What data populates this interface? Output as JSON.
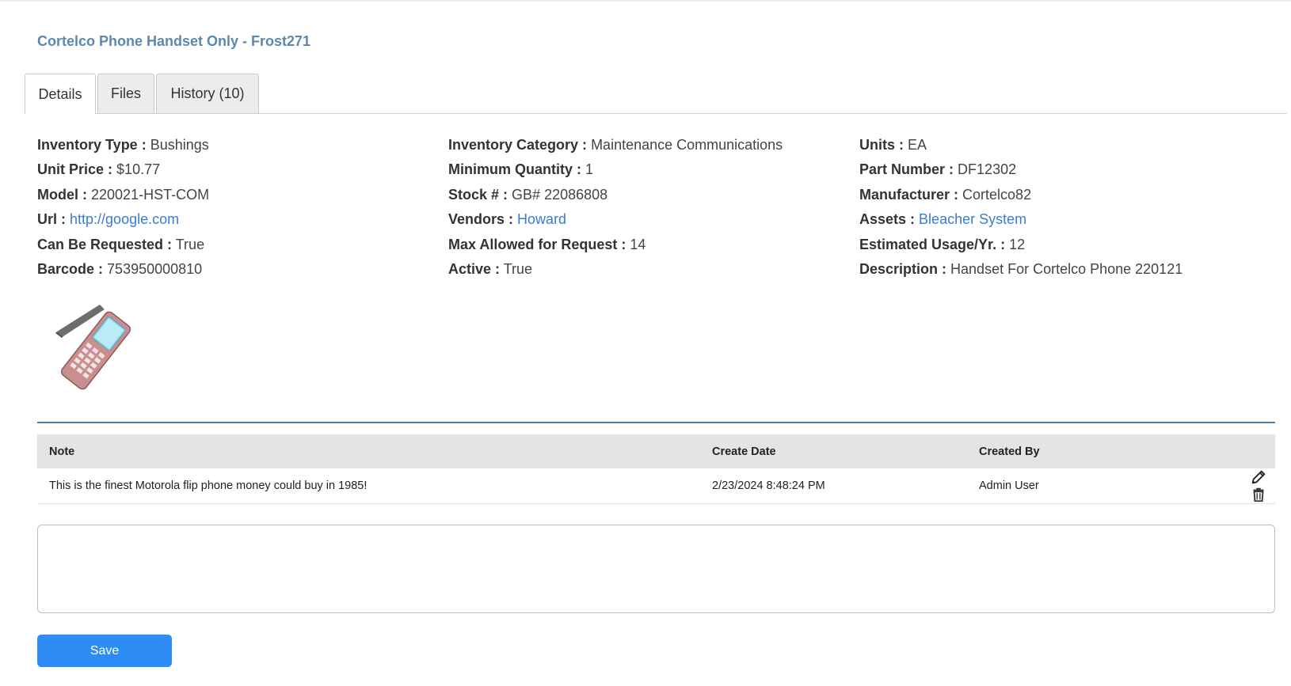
{
  "title": "Cortelco Phone Handset Only - Frost271",
  "tabs": [
    {
      "label": "Details"
    },
    {
      "label": "Files"
    },
    {
      "label": "History (10)"
    }
  ],
  "columns": [
    [
      {
        "label": "Inventory Type :",
        "value": "Bushings"
      },
      {
        "label": "Unit Price :",
        "value": "$10.77"
      },
      {
        "label": "Model :",
        "value": "220021-HST-COM"
      },
      {
        "label": "Url :",
        "value": "http://google.com",
        "link": true
      },
      {
        "label": "Can Be Requested :",
        "value": "True"
      },
      {
        "label": "Barcode :",
        "value": "753950000810"
      }
    ],
    [
      {
        "label": "Inventory Category :",
        "value": "Maintenance Communications"
      },
      {
        "label": "Minimum Quantity :",
        "value": "1"
      },
      {
        "label": "Stock # :",
        "value": "GB# 22086808"
      },
      {
        "label": "Vendors :",
        "value": "Howard",
        "link": true
      },
      {
        "label": "Max Allowed for Request :",
        "value": "14"
      },
      {
        "label": "Active :",
        "value": "True"
      }
    ],
    [
      {
        "label": "Units :",
        "value": "EA"
      },
      {
        "label": "Part Number :",
        "value": "DF12302"
      },
      {
        "label": "Manufacturer :",
        "value": "Cortelco82"
      },
      {
        "label": "Assets :",
        "value": "Bleacher System",
        "link": true
      },
      {
        "label": "Estimated Usage/Yr. :",
        "value": "12"
      },
      {
        "label": "Description :",
        "value": "Handset For Cortelco Phone 220121"
      }
    ]
  ],
  "notes": {
    "headers": {
      "note": "Note",
      "create_date": "Create Date",
      "created_by": "Created By"
    },
    "rows": [
      {
        "note": "This is the finest Motorola flip phone money could buy in 1985!",
        "create_date": "2/23/2024 8:48:24 PM",
        "created_by": "Admin User"
      }
    ],
    "input_value": "",
    "save_label": "Save"
  },
  "colors": {
    "title": "#5d88ad",
    "link": "#3a7bd5",
    "save_button": "#2e8cf7",
    "rule": "#4d7fa8"
  },
  "icons": {
    "image": "flip-phone-icon",
    "edit": "pencil-icon",
    "delete": "trash-icon"
  }
}
